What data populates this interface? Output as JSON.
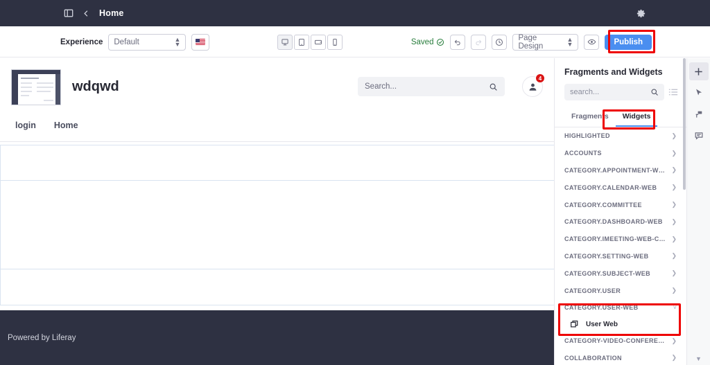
{
  "topbar": {
    "sidebar_toggle_icon": "panel-icon",
    "back_icon": "chevron-left-icon",
    "title": "Home",
    "settings_icon": "gear-icon"
  },
  "controlbar": {
    "experience_label": "Experience",
    "experience_value": "Default",
    "language_flag": "us-flag-icon",
    "devices": [
      {
        "name": "desktop",
        "icon": "desktop-icon",
        "active": true
      },
      {
        "name": "tablet",
        "icon": "tablet-icon",
        "active": false
      },
      {
        "name": "tablet-landscape",
        "icon": "tablet-landscape-icon",
        "active": false
      },
      {
        "name": "mobile",
        "icon": "mobile-icon",
        "active": false
      }
    ],
    "saved_label": "Saved",
    "saved_icon": "check-circle-icon",
    "undo_icon": "undo-icon",
    "redo_icon": "redo-icon",
    "history_icon": "clock-icon",
    "page_design_value": "Page Design",
    "preview_icon": "eye-icon",
    "publish_label": "Publish",
    "publish_color": "#4a8ef0"
  },
  "page": {
    "logo_alt": "site-logo-thumbnail",
    "site_title": "wdqwd",
    "search_placeholder": "Search...",
    "search_icon": "search-icon",
    "avatar_icon": "user-icon",
    "avatar_badge": "4",
    "nav": [
      {
        "label": "login"
      },
      {
        "label": "Home"
      }
    ],
    "dropzones": [
      {
        "name": "dropzone-1"
      },
      {
        "name": "dropzone-2"
      },
      {
        "name": "dropzone-3"
      }
    ],
    "footer_text": "Powered by Liferay"
  },
  "sidebar": {
    "title": "Fragments and Widgets",
    "search_placeholder": "search...",
    "search_icon": "search-icon",
    "list_view_icon": "list-view-icon",
    "tabs": [
      {
        "label": "Fragments",
        "active": false
      },
      {
        "label": "Widgets",
        "active": true
      }
    ],
    "categories": [
      {
        "label": "HIGHLIGHTED",
        "expanded": false
      },
      {
        "label": "ACCOUNTS",
        "expanded": false
      },
      {
        "label": "CATEGORY.APPOINTMENT-WEB",
        "expanded": false
      },
      {
        "label": "CATEGORY.CALENDAR-WEB",
        "expanded": false
      },
      {
        "label": "CATEGORY.COMMITTEE",
        "expanded": false
      },
      {
        "label": "CATEGORY.DASHBOARD-WEB",
        "expanded": false
      },
      {
        "label": "CATEGORY.IMEETING-WEB-CO...",
        "expanded": false
      },
      {
        "label": "CATEGORY.SETTING-WEB",
        "expanded": false
      },
      {
        "label": "CATEGORY.SUBJECT-WEB",
        "expanded": false
      },
      {
        "label": "CATEGORY.USER",
        "expanded": false
      },
      {
        "label": "CATEGORY.USER-WEB",
        "expanded": true
      },
      {
        "label": "CATEGORY-VIDEO-CONFERENCES",
        "expanded": false
      },
      {
        "label": "COLLABORATION",
        "expanded": false
      }
    ],
    "widget_item": {
      "label": "User Web",
      "icon": "widget-icon"
    },
    "scroll_down_icon": "caret-down-icon"
  },
  "rail": {
    "buttons": [
      {
        "name": "add-icon",
        "icon": "plus-icon",
        "active": true
      },
      {
        "name": "select-icon",
        "icon": "cursor-icon",
        "active": false
      },
      {
        "name": "mapping-icon",
        "icon": "stamp-icon",
        "active": false
      },
      {
        "name": "comments-icon",
        "icon": "comment-icon",
        "active": false
      }
    ]
  },
  "annotations": {
    "color": "#ee0000",
    "targets": [
      "publish-button",
      "widgets-tab",
      "category-user-web-group"
    ]
  }
}
